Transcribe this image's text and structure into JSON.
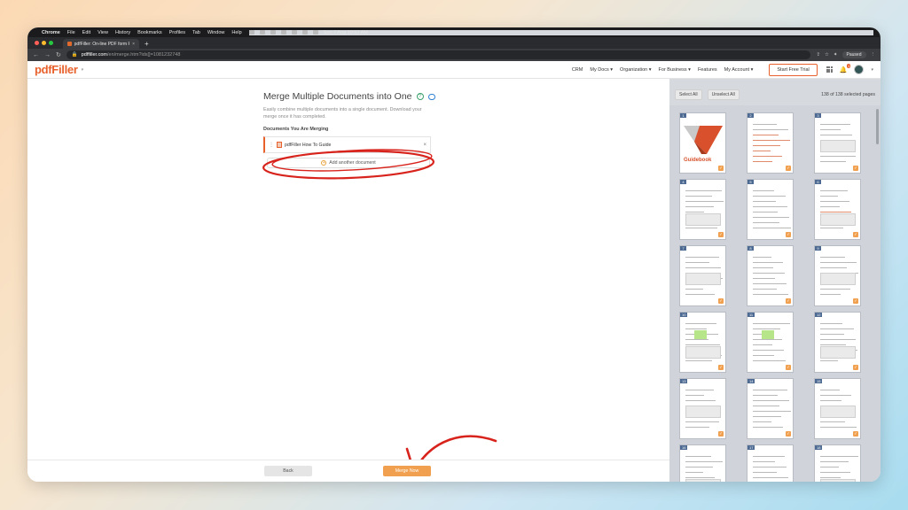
{
  "menubar": {
    "app": "Chrome",
    "items": [
      "File",
      "Edit",
      "View",
      "History",
      "Bookmarks",
      "Profiles",
      "Tab",
      "Window",
      "Help"
    ],
    "datetime": "Sun 7 Aug  10:52 AM"
  },
  "browser": {
    "tab_title": "pdfFiller: On-line PDF form Fill",
    "url_host": "pdffiller.com",
    "url_path": "/en/merge.htm?ids[]=1081232748",
    "profile_label": "Paused"
  },
  "header": {
    "logo": "pdfFiller",
    "nav": [
      "CRM",
      "My Docs",
      "Organization",
      "For Business",
      "Features",
      "My Account"
    ],
    "trial_label": "Start Free Trial",
    "notif_count": "1"
  },
  "merge": {
    "title": "Merge Multiple Documents into One",
    "description": "Easily combine multiple documents into a single document. Download your merge once it has completed.",
    "subtitle": "Documents You Are Merging",
    "document_name": "pdfFiller How To Guide",
    "add_label": "Add another document",
    "back_label": "Back",
    "merge_label": "Merge Now"
  },
  "pages_panel": {
    "select_all": "Select All",
    "unselect_all": "Unselect All",
    "count_label": "138 of 138 selected pages",
    "cover_text": "Guidebook",
    "pages": [
      "1",
      "2",
      "3",
      "4",
      "5",
      "6",
      "7",
      "8",
      "9",
      "10",
      "11",
      "12",
      "13",
      "14",
      "15",
      "16",
      "17",
      "18"
    ]
  }
}
